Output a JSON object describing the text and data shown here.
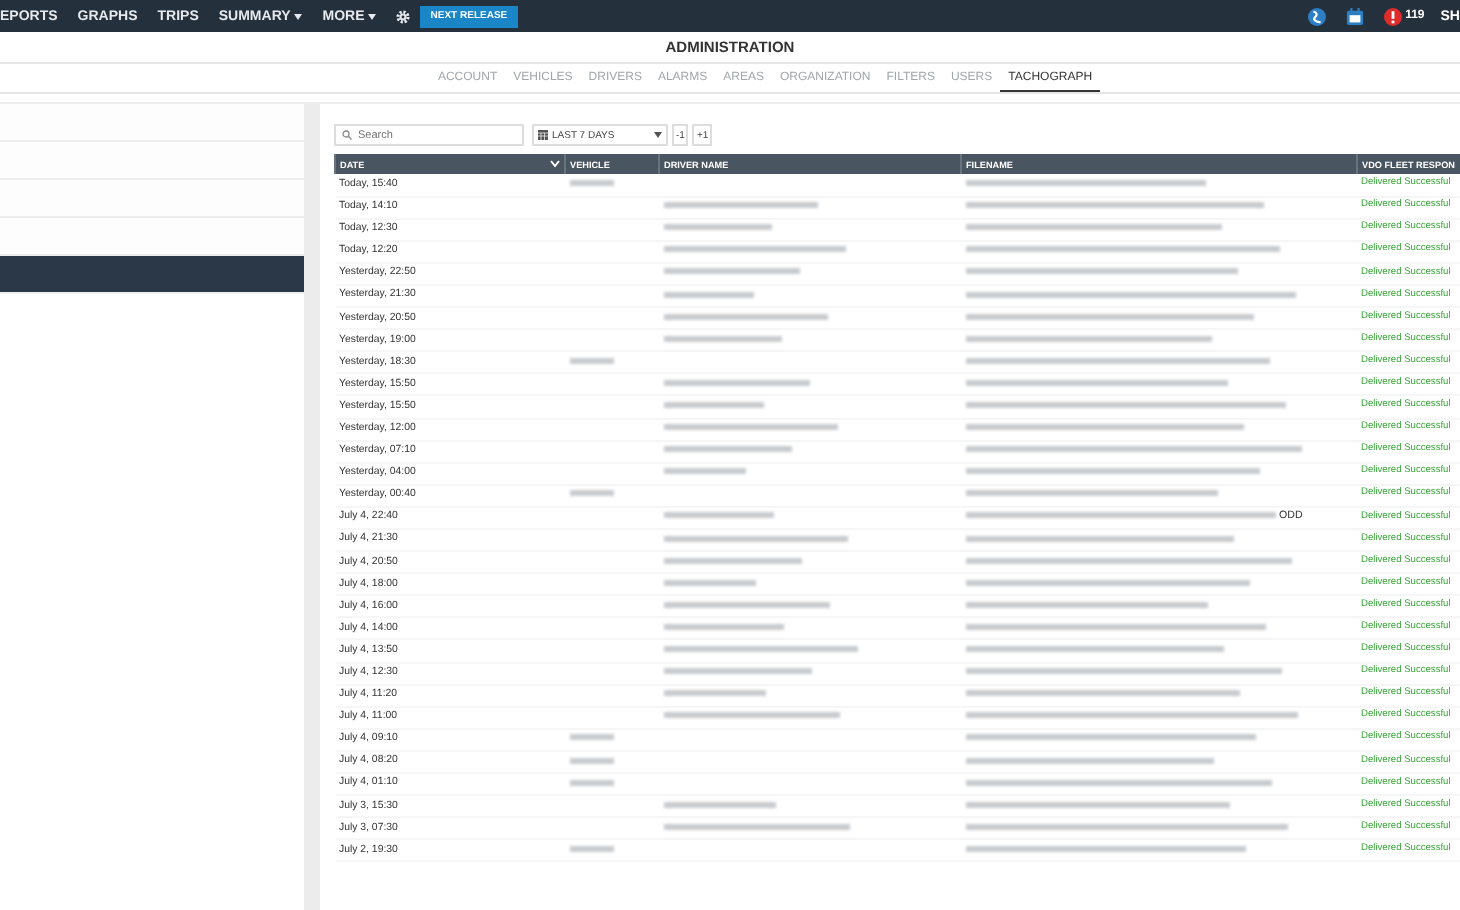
{
  "top_nav": {
    "items": [
      {
        "label": "EPORTS",
        "dropdown": false
      },
      {
        "label": "GRAPHS",
        "dropdown": false
      },
      {
        "label": "TRIPS",
        "dropdown": false
      },
      {
        "label": "SUMMARY",
        "dropdown": true
      },
      {
        "label": "MORE",
        "dropdown": true
      }
    ],
    "release_button": "NEXT RELEASE",
    "alert_count": "119",
    "user": "SH"
  },
  "page_title": "ADMINISTRATION",
  "tabs": [
    {
      "label": "ACCOUNT",
      "selected": false
    },
    {
      "label": "VEHICLES",
      "selected": false
    },
    {
      "label": "DRIVERS",
      "selected": false
    },
    {
      "label": "ALARMS",
      "selected": false
    },
    {
      "label": "AREAS",
      "selected": false
    },
    {
      "label": "ORGANIZATION",
      "selected": false
    },
    {
      "label": "FILTERS",
      "selected": false
    },
    {
      "label": "USERS",
      "selected": false
    },
    {
      "label": "TACHOGRAPH",
      "selected": true
    }
  ],
  "sidebar": {
    "items": [
      {
        "selected": false
      },
      {
        "selected": false
      },
      {
        "selected": false
      },
      {
        "selected": false
      },
      {
        "selected": true
      }
    ]
  },
  "toolbar": {
    "search": {
      "placeholder": "Search"
    },
    "period": "LAST 7 DAYS",
    "prev": "-1",
    "next": "+1"
  },
  "table": {
    "columns": [
      "DATE",
      "VEHICLE",
      "DRIVER NAME",
      "FILENAME",
      "VDO FLEET RESPON"
    ],
    "rows": [
      {
        "date": "Today, 15:40",
        "vehicle_redacted": true,
        "driver_redacted": false,
        "response": "Delivered Successful"
      },
      {
        "date": "Today, 14:10",
        "vehicle_redacted": false,
        "driver_redacted": true,
        "response": "Delivered Successful"
      },
      {
        "date": "Today, 12:30",
        "vehicle_redacted": false,
        "driver_redacted": true,
        "response": "Delivered Successful"
      },
      {
        "date": "Today, 12:20",
        "vehicle_redacted": false,
        "driver_redacted": true,
        "response": "Delivered Successful"
      },
      {
        "date": "Yesterday, 22:50",
        "vehicle_redacted": false,
        "driver_redacted": true,
        "response": "Delivered Successful"
      },
      {
        "date": "Yesterday, 21:30",
        "vehicle_redacted": false,
        "driver_redacted": true,
        "response": "Delivered Successful"
      },
      {
        "date": "Yesterday, 20:50",
        "vehicle_redacted": false,
        "driver_redacted": true,
        "response": "Delivered Successful"
      },
      {
        "date": "Yesterday, 19:00",
        "vehicle_redacted": false,
        "driver_redacted": true,
        "response": "Delivered Successful"
      },
      {
        "date": "Yesterday, 18:30",
        "vehicle_redacted": true,
        "driver_redacted": false,
        "response": "Delivered Successful"
      },
      {
        "date": "Yesterday, 15:50",
        "vehicle_redacted": false,
        "driver_redacted": true,
        "response": "Delivered Successful"
      },
      {
        "date": "Yesterday, 15:50",
        "vehicle_redacted": false,
        "driver_redacted": true,
        "response": "Delivered Successful"
      },
      {
        "date": "Yesterday, 12:00",
        "vehicle_redacted": false,
        "driver_redacted": true,
        "response": "Delivered Successful"
      },
      {
        "date": "Yesterday, 07:10",
        "vehicle_redacted": false,
        "driver_redacted": true,
        "response": "Delivered Successful"
      },
      {
        "date": "Yesterday, 04:00",
        "vehicle_redacted": false,
        "driver_redacted": true,
        "response": "Delivered Successful"
      },
      {
        "date": "Yesterday, 00:40",
        "vehicle_redacted": true,
        "driver_redacted": false,
        "response": "Delivered Successful"
      },
      {
        "date": "July 4, 22:40",
        "vehicle_redacted": false,
        "driver_redacted": true,
        "filename_tail": "ODD",
        "response": "Delivered Successful"
      },
      {
        "date": "July 4, 21:30",
        "vehicle_redacted": false,
        "driver_redacted": true,
        "response": "Delivered Successful"
      },
      {
        "date": "July 4, 20:50",
        "vehicle_redacted": false,
        "driver_redacted": true,
        "response": "Delivered Successful"
      },
      {
        "date": "July 4, 18:00",
        "vehicle_redacted": false,
        "driver_redacted": true,
        "response": "Delivered Successful"
      },
      {
        "date": "July 4, 16:00",
        "vehicle_redacted": false,
        "driver_redacted": true,
        "response": "Delivered Successful"
      },
      {
        "date": "July 4, 14:00",
        "vehicle_redacted": false,
        "driver_redacted": true,
        "response": "Delivered Successful"
      },
      {
        "date": "July 4, 13:50",
        "vehicle_redacted": false,
        "driver_redacted": true,
        "response": "Delivered Successful"
      },
      {
        "date": "July 4, 12:30",
        "vehicle_redacted": false,
        "driver_redacted": true,
        "response": "Delivered Successful"
      },
      {
        "date": "July 4, 11:20",
        "vehicle_redacted": false,
        "driver_redacted": true,
        "response": "Delivered Successful"
      },
      {
        "date": "July 4, 11:00",
        "vehicle_redacted": false,
        "driver_redacted": true,
        "response": "Delivered Successful"
      },
      {
        "date": "July 4, 09:10",
        "vehicle_redacted": true,
        "driver_redacted": false,
        "response": "Delivered Successful"
      },
      {
        "date": "July 4, 08:20",
        "vehicle_redacted": true,
        "driver_redacted": false,
        "response": "Delivered Successful"
      },
      {
        "date": "July 4, 01:10",
        "vehicle_redacted": true,
        "driver_redacted": false,
        "response": "Delivered Successful"
      },
      {
        "date": "July 3, 15:30",
        "vehicle_redacted": false,
        "driver_redacted": true,
        "response": "Delivered Successful"
      },
      {
        "date": "July 3, 07:30",
        "vehicle_redacted": false,
        "driver_redacted": true,
        "response": "Delivered Successful"
      },
      {
        "date": "July 2, 19:30",
        "vehicle_redacted": true,
        "driver_redacted": false,
        "response": "Delivered Successful"
      }
    ]
  }
}
